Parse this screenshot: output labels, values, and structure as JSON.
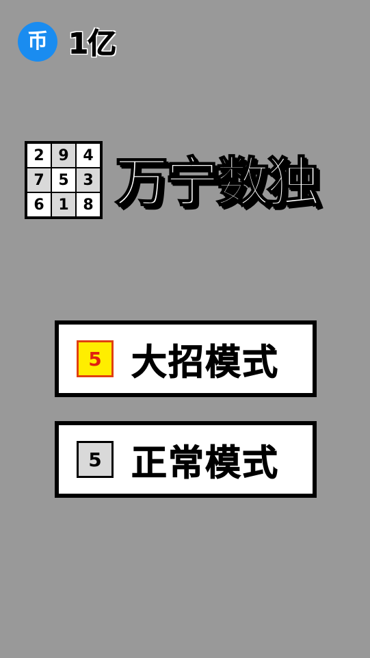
{
  "currency": {
    "icon_glyph": "币",
    "amount": "1亿"
  },
  "logo": {
    "grid": [
      {
        "value": "2",
        "shaded": false
      },
      {
        "value": "9",
        "shaded": true
      },
      {
        "value": "4",
        "shaded": false
      },
      {
        "value": "7",
        "shaded": true
      },
      {
        "value": "5",
        "shaded": false
      },
      {
        "value": "3",
        "shaded": true
      },
      {
        "value": "6",
        "shaded": false
      },
      {
        "value": "1",
        "shaded": true
      },
      {
        "value": "8",
        "shaded": false
      }
    ],
    "title": "万宁数独"
  },
  "modes": {
    "special": {
      "badge": "5",
      "label": "大招模式",
      "badge_bg": "#ffee00",
      "badge_color": "#e02010"
    },
    "normal": {
      "badge": "5",
      "label": "正常模式",
      "badge_bg": "#d9d9d9",
      "badge_color": "#000000"
    }
  },
  "colors": {
    "background": "#999999",
    "coin": "#1a8cf0"
  }
}
